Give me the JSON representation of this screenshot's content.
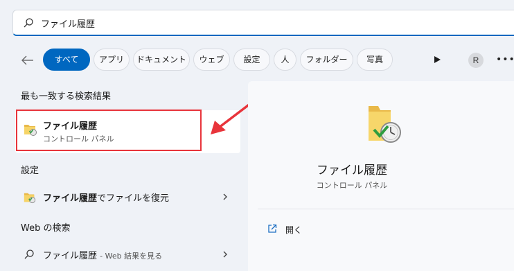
{
  "search": {
    "query": "ファイル履歴",
    "icon": "search-icon"
  },
  "filters": {
    "chips": [
      "すべて",
      "アプリ",
      "ドキュメント",
      "ウェブ",
      "設定",
      "人",
      "フォルダー",
      "写真"
    ],
    "active_index": 0,
    "avatar_letter": "R"
  },
  "left": {
    "best_match_heading": "最も一致する検索結果",
    "best_match": {
      "name": "ファイル履歴",
      "type": "コントロール パネル"
    },
    "settings_heading": "設定",
    "settings_item": {
      "highlight": "ファイル履歴",
      "rest": "でファイルを復元"
    },
    "web_heading": "Web の検索",
    "web_item": {
      "query": "ファイル履歴",
      "suffix": "- Web 結果を見る"
    }
  },
  "detail": {
    "title": "ファイル履歴",
    "subtitle": "コントロール パネル",
    "open_label": "開く"
  },
  "colors": {
    "accent": "#0067c0",
    "highlight_box": "#e8343b"
  }
}
